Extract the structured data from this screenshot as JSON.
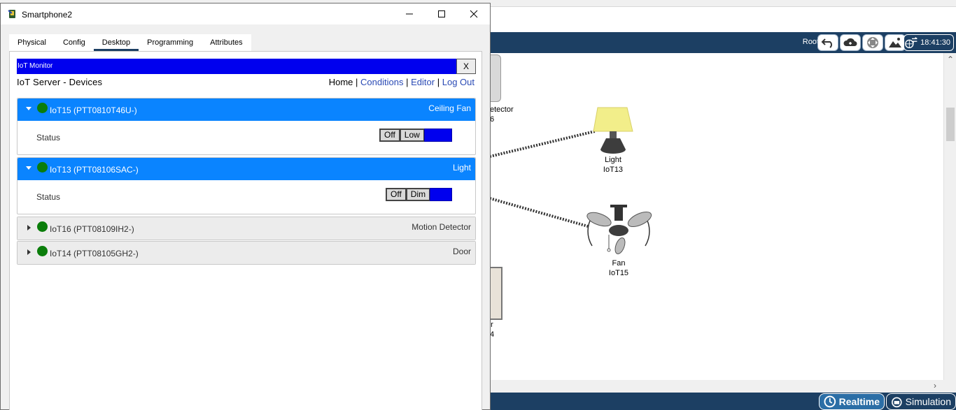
{
  "window": {
    "title": "Smartphone2"
  },
  "tabs": [
    "Physical",
    "Config",
    "Desktop",
    "Programming",
    "Attributes"
  ],
  "active_tab": "Desktop",
  "iot_monitor": {
    "header_title": "IoT Monitor",
    "close_label": "X",
    "server_title": "IoT Server - Devices",
    "nav": {
      "home": "Home",
      "conditions": "Conditions",
      "editor": "Editor",
      "logout": "Log Out",
      "separator": "|"
    },
    "status_color": "#0a7d0a",
    "devices": [
      {
        "name": "IoT15 (PTT0810T46U-)",
        "type": "Ceiling Fan",
        "expanded": true,
        "status_label": "Status",
        "options": [
          "Off",
          "Low"
        ]
      },
      {
        "name": "IoT13 (PTT08106SAC-)",
        "type": "Light",
        "expanded": true,
        "status_label": "Status",
        "options": [
          "Off",
          "Dim"
        ]
      },
      {
        "name": "IoT16 (PTT08109IH2-)",
        "type": "Motion Detector",
        "expanded": false
      },
      {
        "name": "IoT14 (PTT08105GH2-)",
        "type": "Door",
        "expanded": false
      }
    ]
  },
  "workspace": {
    "root_label": "Root",
    "clock": "18:41:30",
    "canvas_labels": {
      "detector_partial": "etector",
      "detector_partial_2": "6",
      "light_name": "Light",
      "light_id": "IoT13",
      "fan_name": "Fan",
      "fan_id": "IoT15",
      "door_partial": "r",
      "door_partial_2": "4"
    },
    "realtime_label": "Realtime",
    "simulation_label": "Simulation"
  }
}
